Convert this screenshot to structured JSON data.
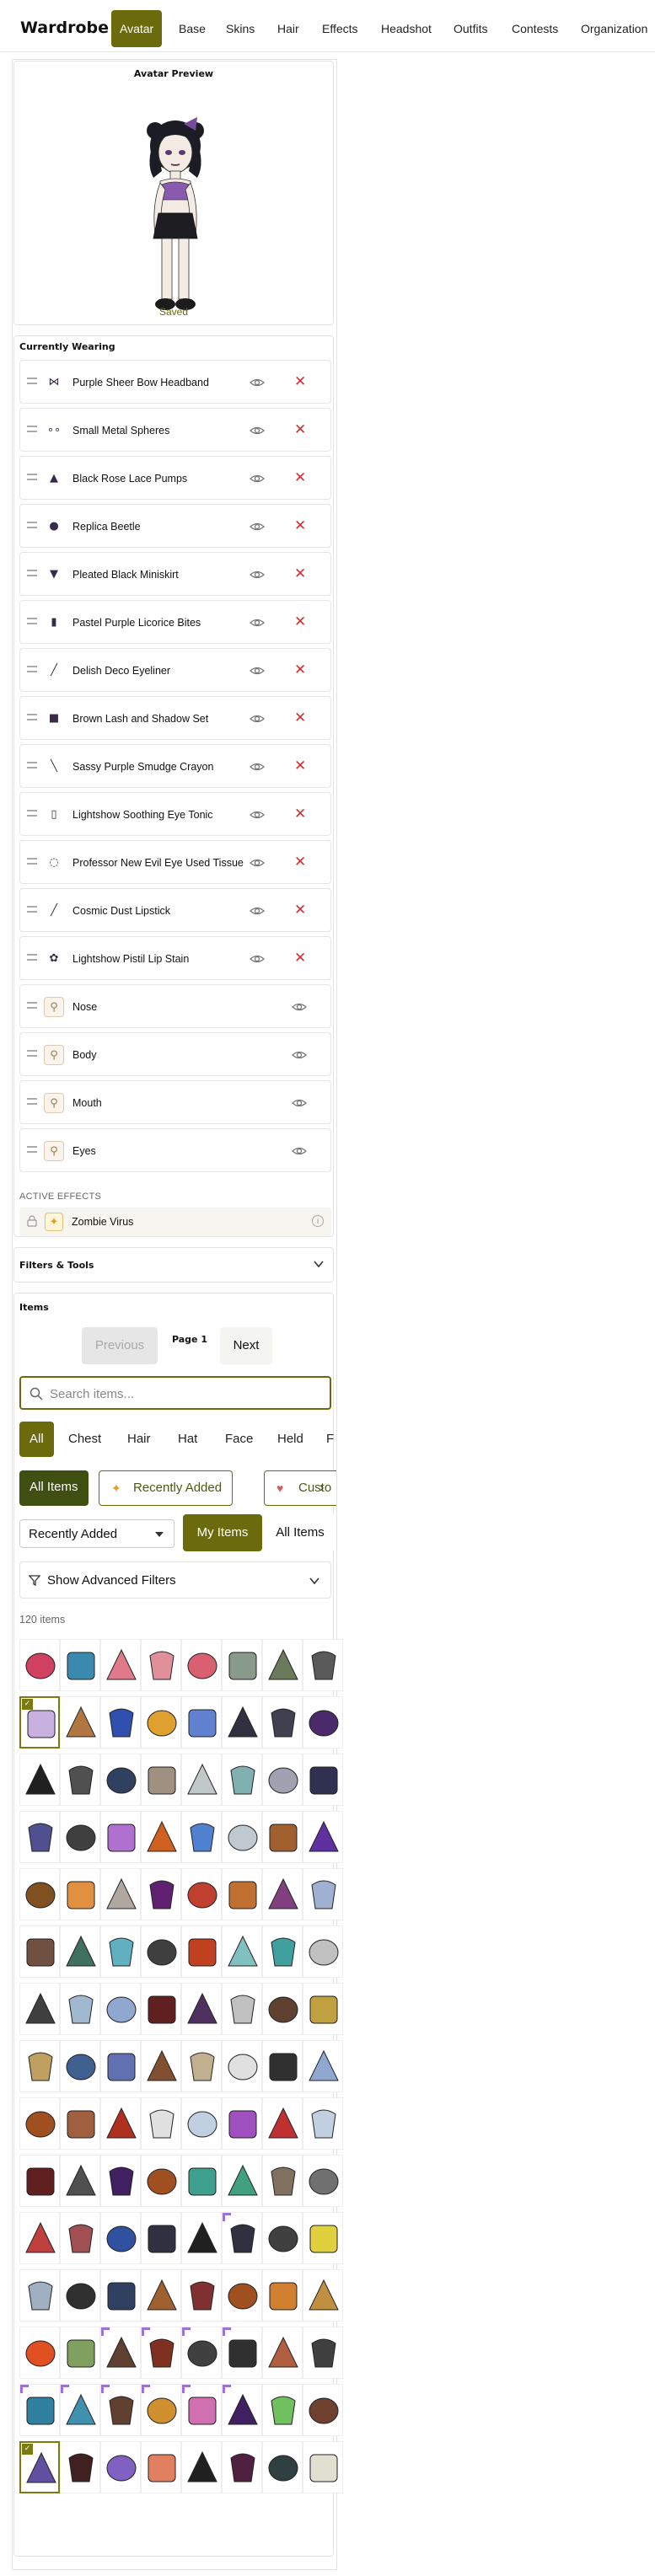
{
  "header": {
    "app_title": "Wardrobe",
    "tabs": [
      {
        "label": "Avatar",
        "active": true
      },
      {
        "label": "Base"
      },
      {
        "label": "Skins"
      },
      {
        "label": "Hair"
      },
      {
        "label": "Effects"
      },
      {
        "label": "Headshot"
      },
      {
        "label": "Outfits"
      },
      {
        "label": "Contests"
      },
      {
        "label": "Organization"
      }
    ]
  },
  "preview": {
    "title": "Avatar Preview",
    "status": "Saved"
  },
  "wearing": {
    "title": "Currently Wearing",
    "items": [
      {
        "name": "Purple Sheer Bow Headband",
        "icon": "bow-headband-icon",
        "removable": true
      },
      {
        "name": "Small Metal Spheres",
        "icon": "metal-spheres-icon",
        "removable": true
      },
      {
        "name": "Black Rose Lace Pumps",
        "icon": "pumps-icon",
        "removable": true
      },
      {
        "name": "Replica Beetle",
        "icon": "beetle-icon",
        "removable": true
      },
      {
        "name": "Pleated Black Miniskirt",
        "icon": "miniskirt-icon",
        "removable": true
      },
      {
        "name": "Pastel Purple Licorice Bites",
        "icon": "licorice-icon",
        "removable": true
      },
      {
        "name": "Delish Deco Eyeliner",
        "icon": "eyeliner-icon",
        "removable": true
      },
      {
        "name": "Brown Lash and Shadow Set",
        "icon": "makeup-set-icon",
        "removable": true
      },
      {
        "name": "Sassy Purple Smudge Crayon",
        "icon": "crayon-icon",
        "removable": true
      },
      {
        "name": "Lightshow Soothing Eye Tonic",
        "icon": "tonic-icon",
        "removable": true
      },
      {
        "name": "Professor New Evil Eye Used Tissue",
        "icon": "tissue-icon",
        "removable": true
      },
      {
        "name": "Cosmic Dust Lipstick",
        "icon": "lipstick-icon",
        "removable": true
      },
      {
        "name": "Lightshow Pistil Lip Stain",
        "icon": "lip-stain-icon",
        "removable": true
      },
      {
        "name": "Nose",
        "icon": "person-icon",
        "removable": false
      },
      {
        "name": "Body",
        "icon": "person-icon",
        "removable": false
      },
      {
        "name": "Mouth",
        "icon": "person-icon",
        "removable": false
      },
      {
        "name": "Eyes",
        "icon": "person-icon",
        "removable": false
      }
    ],
    "remove_glyph": "✕"
  },
  "effects": {
    "label": "ACTIVE EFFECTS",
    "items": [
      {
        "name": "Zombie Virus",
        "icon": "sparkle-icon"
      }
    ]
  },
  "filters": {
    "title": "Filters & Tools"
  },
  "items": {
    "title": "Items",
    "pagination": {
      "prev_label": "Previous",
      "page_label": "Page 1",
      "next_label": "Next"
    },
    "search": {
      "placeholder": "Search items...",
      "value": ""
    },
    "categories": [
      {
        "label": "All",
        "active": true
      },
      {
        "label": "Chest"
      },
      {
        "label": "Hair"
      },
      {
        "label": "Hat"
      },
      {
        "label": "Face"
      },
      {
        "label": "Held"
      },
      {
        "label": "F"
      }
    ],
    "subfilters": [
      {
        "label": "All Items",
        "active": true
      },
      {
        "label": "Recently Added",
        "icon": "sparkle-icon"
      },
      {
        "label": "Custo",
        "icon": "heart-icon"
      }
    ],
    "sort": {
      "value": "Recently Added"
    },
    "ownership": [
      {
        "label": "My Items",
        "active": true
      },
      {
        "label": "All Items"
      }
    ],
    "advanced_filters_label": "Show Advanced Filters",
    "count_text": "120 items",
    "tile_colors": [
      [
        "#d04060",
        "#3a8ab0",
        "#e07a8a",
        "#e0909a",
        "#d86070",
        "#8a9a8a",
        "#6a7a5a",
        "#5a5a5a"
      ],
      [
        "#c8b0e0",
        "#b07840",
        "#3050b0",
        "#e0a030",
        "#6080d0",
        "#303040",
        "#404050",
        "#4a2a6a"
      ],
      [
        "#202020",
        "#505050",
        "#304060",
        "#a09080",
        "#c0c8c8",
        "#80b0b0",
        "#a0a0b0",
        "#303050"
      ],
      [
        "#505090",
        "#404040",
        "#b070d0",
        "#d06020",
        "#5080d0",
        "#c0c8d0",
        "#a06030",
        "#6030a0"
      ],
      [
        "#805020",
        "#e09040",
        "#b0a8a0",
        "#602070",
        "#c04030",
        "#c07030",
        "#804080",
        "#a0b0d0"
      ],
      [
        "#705040",
        "#407060",
        "#60b0c0",
        "#404040",
        "#c04020",
        "#80c0c0",
        "#40a0a0",
        "#c0c0c0"
      ],
      [
        "#404040",
        "#a0b8d0",
        "#90a8d0",
        "#602020",
        "#503060",
        "#c0c0c0",
        "#604030",
        "#c0a040"
      ],
      [
        "#c0a060",
        "#406090",
        "#6070b0",
        "#805030",
        "#c0b090",
        "#e0e0e0",
        "#303030",
        "#90a8d0"
      ],
      [
        "#a05020",
        "#a06040",
        "#b03020",
        "#e0e0e0",
        "#c0d0e0",
        "#a050c0",
        "#c03030",
        "#c0d0e0"
      ],
      [
        "#602020",
        "#505050",
        "#402060",
        "#a05020",
        "#40a090",
        "#40a080",
        "#807060",
        "#707070"
      ],
      [
        "#c04040",
        "#a05050",
        "#3050a0",
        "#303040",
        "#202020",
        "#303040",
        "#404040",
        "#e0d040"
      ],
      [
        "#a0b0c0",
        "#303030",
        "#304060",
        "#a06030",
        "#803030",
        "#a05020",
        "#d08030",
        "#c09040"
      ],
      [
        "#e05020",
        "#80a060",
        "#604030",
        "#803020",
        "#404040",
        "#303030",
        "#b06040",
        "#404040"
      ],
      [
        "#3080a0",
        "#4090b0",
        "#604030",
        "#d09030",
        "#d070b0",
        "#402060",
        "#70c060",
        "#704030"
      ],
      [
        "#6050a0",
        "#402020",
        "#8060c0",
        "#e08060",
        "#202020",
        "#502040",
        "#304040",
        "#e0e0d0"
      ]
    ],
    "equipped_tiles": [
      [
        1,
        0
      ],
      [
        14,
        0
      ]
    ],
    "new_badge_tiles": [
      [
        10,
        5
      ],
      [
        12,
        2
      ],
      [
        12,
        3
      ],
      [
        12,
        4
      ],
      [
        12,
        5
      ],
      [
        13,
        0
      ],
      [
        13,
        1
      ],
      [
        13,
        2
      ],
      [
        13,
        3
      ],
      [
        13,
        4
      ],
      [
        13,
        5
      ]
    ]
  }
}
